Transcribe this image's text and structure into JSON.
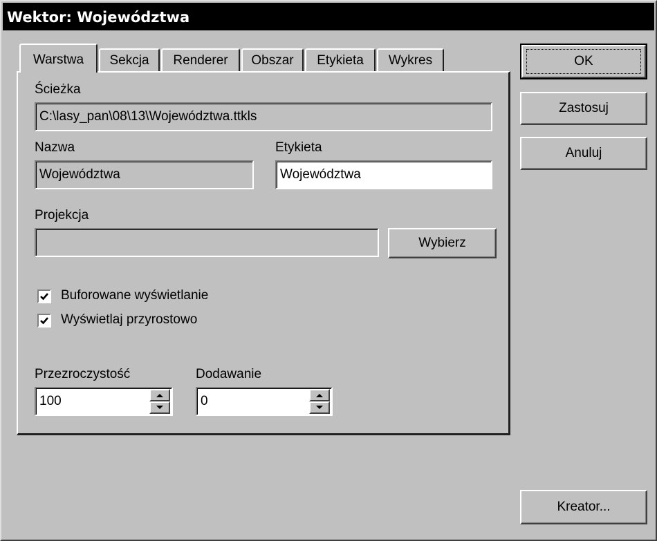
{
  "window": {
    "title": "Wektor: Województwa"
  },
  "tabs": [
    {
      "label": "Warstwa",
      "active": true
    },
    {
      "label": "Sekcja",
      "active": false
    },
    {
      "label": "Renderer",
      "active": false
    },
    {
      "label": "Obszar",
      "active": false
    },
    {
      "label": "Etykieta",
      "active": false
    },
    {
      "label": "Wykres",
      "active": false
    }
  ],
  "path": {
    "label": "Ścieżka",
    "value": "C:\\lasy_pan\\08\\13\\Województwa.ttkls"
  },
  "name": {
    "label": "Nazwa",
    "value": "Województwa"
  },
  "label_field": {
    "label": "Etykieta",
    "value": "Województwa"
  },
  "projection": {
    "label": "Projekcja",
    "value": "",
    "choose_button": "Wybierz"
  },
  "checkboxes": [
    {
      "label": "Buforowane wyświetlanie",
      "checked": true
    },
    {
      "label": "Wyświetlaj przyrostowo",
      "checked": true
    }
  ],
  "transparency": {
    "label": "Przezroczystość",
    "value": "100"
  },
  "adding": {
    "label": "Dodawanie",
    "value": "0"
  },
  "buttons": {
    "ok": "OK",
    "apply": "Zastosuj",
    "cancel": "Anuluj",
    "wizard": "Kreator..."
  }
}
